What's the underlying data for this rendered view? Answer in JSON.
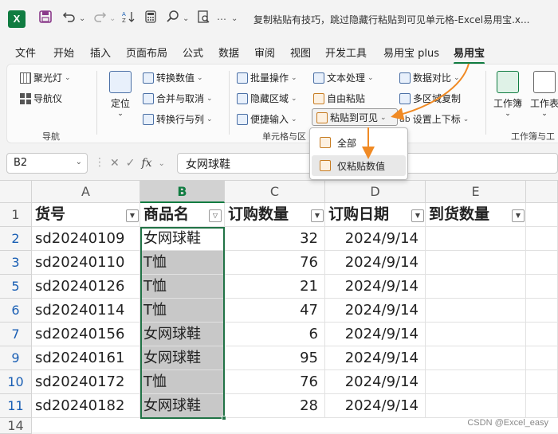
{
  "app": {
    "logo_letter": "X",
    "title": "复制粘贴有技巧，跳过隐藏行粘贴到可见单元格-Excel易用宝.x..."
  },
  "menu_tabs": [
    "文件",
    "开始",
    "插入",
    "页面布局",
    "公式",
    "数据",
    "审阅",
    "视图",
    "开发工具",
    "易用宝 plus",
    "易用宝"
  ],
  "active_tab": "易用宝",
  "ribbon": {
    "nav": {
      "spotlight": "聚光灯",
      "navigator": "导航仪",
      "group_label": "导航"
    },
    "locate": "定位",
    "cells_group": {
      "convert_values": "转换数值",
      "merge_unmerge": "合并与取消",
      "convert_rows_cols": "转换行与列",
      "batch_ops": "批量操作",
      "hidden_area": "隐藏区域",
      "quick_input": "便捷输入",
      "text_process": "文本处理",
      "free_paste": "自由粘贴",
      "paste_visible": "粘贴到可见",
      "data_compare": "数据对比",
      "multi_copy": "多区域复制",
      "superscript": "设置上下标",
      "group_label": "单元格与区"
    },
    "workbook": {
      "label": "工作簿",
      "sheet_label": "工作表",
      "group_label": "工作簿与工"
    }
  },
  "dropdown": {
    "items": [
      "全部",
      "仅粘贴数值"
    ],
    "highlighted": 1
  },
  "formula_bar": {
    "name_box": "B2",
    "fx": "fx",
    "formula": "女网球鞋"
  },
  "grid": {
    "columns": [
      "A",
      "B",
      "C",
      "D",
      "E"
    ],
    "selected_column": "B",
    "headers": [
      "货号",
      "商品名",
      "订购数量",
      "订购日期",
      "到货数量"
    ],
    "rows": [
      {
        "row": "2",
        "a": "sd20240109",
        "b": "女网球鞋",
        "c": "32",
        "d": "2024/9/14"
      },
      {
        "row": "3",
        "a": "sd20240110",
        "b": "T恤",
        "c": "76",
        "d": "2024/9/14"
      },
      {
        "row": "5",
        "a": "sd20240126",
        "b": "T恤",
        "c": "21",
        "d": "2024/9/14"
      },
      {
        "row": "6",
        "a": "sd20240114",
        "b": "T恤",
        "c": "47",
        "d": "2024/9/14"
      },
      {
        "row": "7",
        "a": "sd20240156",
        "b": "女网球鞋",
        "c": "6",
        "d": "2024/9/14"
      },
      {
        "row": "9",
        "a": "sd20240161",
        "b": "女网球鞋",
        "c": "95",
        "d": "2024/9/14"
      },
      {
        "row": "10",
        "a": "sd20240172",
        "b": "T恤",
        "c": "76",
        "d": "2024/9/14"
      },
      {
        "row": "11",
        "a": "sd20240182",
        "b": "女网球鞋",
        "c": "28",
        "d": "2024/9/14"
      }
    ],
    "next_row": "14"
  },
  "watermark": "CSDN @Excel_easy",
  "colors": {
    "accent": "#107c41",
    "arrow": "#f08a24",
    "selection": "#217346"
  }
}
